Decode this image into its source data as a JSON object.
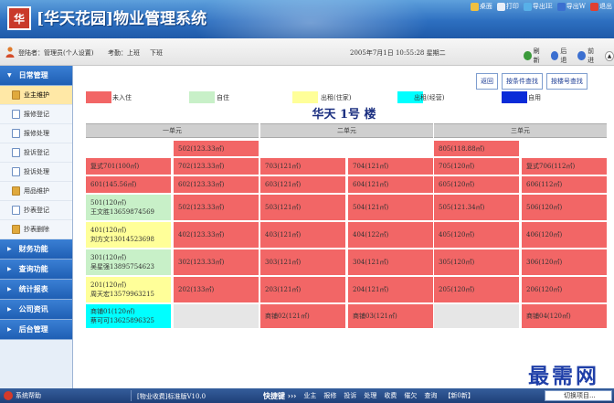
{
  "header": {
    "logo_char": "华",
    "title": "[华天花园]物业管理系统",
    "tools": [
      {
        "label": "桌面",
        "icon": "home-icon",
        "color": "#f0c040"
      },
      {
        "label": "打印",
        "icon": "print-icon",
        "color": "#e8eef8"
      },
      {
        "label": "导出IE",
        "icon": "export-ie-icon",
        "color": "#58b0e8"
      },
      {
        "label": "导出W",
        "icon": "export-word-icon",
        "color": "#3b6fd0"
      },
      {
        "label": "退出",
        "icon": "exit-icon",
        "color": "#e04030"
      }
    ]
  },
  "infobar": {
    "user_label": "登陆者：管理员(个人设置)",
    "attendance_label": "考勤：上班",
    "off_label": "下班",
    "datetime": "2005年7月1日 10:55:28 星期二",
    "nav": [
      {
        "label": "刷新",
        "icon": "refresh-icon"
      },
      {
        "label": "后退",
        "icon": "back-icon"
      },
      {
        "label": "前进",
        "icon": "forward-icon"
      }
    ]
  },
  "sidebar": {
    "sections": [
      {
        "label": "日常管理",
        "open": true,
        "items": [
          {
            "label": "业主维护",
            "active": true,
            "icon": "folder-icon"
          },
          {
            "label": "报修登记",
            "icon": "document-icon"
          },
          {
            "label": "报修处理",
            "icon": "document-icon"
          },
          {
            "label": "投诉登记",
            "icon": "document-icon"
          },
          {
            "label": "投诉处理",
            "icon": "document-icon"
          },
          {
            "label": "用品维护",
            "icon": "folder-icon"
          },
          {
            "label": "抄表登记",
            "icon": "document-icon"
          },
          {
            "label": "抄表删除",
            "icon": "folder-icon"
          }
        ]
      },
      {
        "label": "财务功能"
      },
      {
        "label": "查询功能"
      },
      {
        "label": "统计报表"
      },
      {
        "label": "公司资讯"
      },
      {
        "label": "后台管理"
      }
    ]
  },
  "main": {
    "links": [
      "返回",
      "按条件查找",
      "按楼号查找"
    ],
    "legend": [
      {
        "label": "未入住",
        "color": "#f26666"
      },
      {
        "label": "自住",
        "color": "#c8f0c8"
      },
      {
        "label": "出租(住家)",
        "color": "#ffff99"
      },
      {
        "label": "出租(经营)",
        "color": "#00ffff"
      },
      {
        "label": "自用",
        "color": "#0a2bd8"
      }
    ],
    "building_title": "华天 1号 楼",
    "units": [
      "一单元",
      "二单元",
      "三单元"
    ],
    "rows": [
      [
        [
          {
            "lines": [
              "502(123.33㎡)"
            ],
            "status": "vacant",
            "col": 1
          }
        ],
        [],
        [
          {
            "lines": [
              "805(118.88㎡)"
            ],
            "status": "vacant",
            "col": 0
          }
        ]
      ],
      [
        [
          {
            "lines": [
              "复式701(100㎡)"
            ],
            "status": "vacant",
            "col": 0
          },
          {
            "lines": [
              "702(123.33㎡)"
            ],
            "status": "vacant",
            "col": 1
          }
        ],
        [
          {
            "lines": [
              "703(121㎡)"
            ],
            "status": "vacant",
            "col": 0
          },
          {
            "lines": [
              "704(121㎡)"
            ],
            "status": "vacant",
            "col": 1
          }
        ],
        [
          {
            "lines": [
              "705(120㎡)"
            ],
            "status": "vacant",
            "col": 0
          },
          {
            "lines": [
              "复式706(112㎡)"
            ],
            "status": "vacant",
            "col": 1
          }
        ]
      ],
      [
        [
          {
            "lines": [
              "601(145.56㎡)"
            ],
            "status": "vacant",
            "col": 0
          },
          {
            "lines": [
              "602(123.33㎡)"
            ],
            "status": "vacant",
            "col": 1
          }
        ],
        [
          {
            "lines": [
              "603(121㎡)"
            ],
            "status": "vacant",
            "col": 0
          },
          {
            "lines": [
              "604(121㎡)"
            ],
            "status": "vacant",
            "col": 1
          }
        ],
        [
          {
            "lines": [
              "605(120㎡)"
            ],
            "status": "vacant",
            "col": 0
          },
          {
            "lines": [
              "606(112㎡)"
            ],
            "status": "vacant",
            "col": 1
          }
        ]
      ],
      [
        [
          {
            "lines": [
              "501(120㎡)",
              "王文胜13659874569"
            ],
            "status": "self",
            "col": 0
          },
          {
            "lines": [
              "502(123.33㎡)"
            ],
            "status": "vacant",
            "col": 1
          }
        ],
        [
          {
            "lines": [
              "503(121㎡)"
            ],
            "status": "vacant",
            "col": 0
          },
          {
            "lines": [
              "504(121㎡)"
            ],
            "status": "vacant",
            "col": 1
          }
        ],
        [
          {
            "lines": [
              "505(121.34㎡)"
            ],
            "status": "vacant",
            "col": 0
          },
          {
            "lines": [
              "506(120㎡)"
            ],
            "status": "vacant",
            "col": 1
          }
        ]
      ],
      [
        [
          {
            "lines": [
              "401(120㎡)",
              "刘方文13014523698"
            ],
            "status": "rent-home",
            "col": 0
          },
          {
            "lines": [
              "402(123.33㎡)"
            ],
            "status": "vacant",
            "col": 1
          }
        ],
        [
          {
            "lines": [
              "403(121㎡)"
            ],
            "status": "vacant",
            "col": 0
          },
          {
            "lines": [
              "404(122㎡)"
            ],
            "status": "vacant",
            "col": 1
          }
        ],
        [
          {
            "lines": [
              "405(120㎡)"
            ],
            "status": "vacant",
            "col": 0
          },
          {
            "lines": [
              "406(120㎡)"
            ],
            "status": "vacant",
            "col": 1
          }
        ]
      ],
      [
        [
          {
            "lines": [
              "301(120㎡)",
              "吴星强13895754623"
            ],
            "status": "self",
            "col": 0
          },
          {
            "lines": [
              "302(123.33㎡)"
            ],
            "status": "vacant",
            "col": 1
          }
        ],
        [
          {
            "lines": [
              "303(121㎡)"
            ],
            "status": "vacant",
            "col": 0
          },
          {
            "lines": [
              "304(121㎡)"
            ],
            "status": "vacant",
            "col": 1
          }
        ],
        [
          {
            "lines": [
              "305(120㎡)"
            ],
            "status": "vacant",
            "col": 0
          },
          {
            "lines": [
              "306(120㎡)"
            ],
            "status": "vacant",
            "col": 1
          }
        ]
      ],
      [
        [
          {
            "lines": [
              "201(120㎡)",
              "周天宏13579963215"
            ],
            "status": "rent-home",
            "col": 0
          },
          {
            "lines": [
              "202(133㎡)"
            ],
            "status": "vacant",
            "col": 1
          }
        ],
        [
          {
            "lines": [
              "203(121㎡)"
            ],
            "status": "vacant",
            "col": 0
          },
          {
            "lines": [
              "204(121㎡)"
            ],
            "status": "vacant",
            "col": 1
          }
        ],
        [
          {
            "lines": [
              "205(120㎡)"
            ],
            "status": "vacant",
            "col": 0
          },
          {
            "lines": [
              "206(120㎡)"
            ],
            "status": "vacant",
            "col": 1
          }
        ]
      ],
      [
        [
          {
            "lines": [
              "商铺01(120㎡)",
              "蔡可可13625896325"
            ],
            "status": "rent-business",
            "col": 0
          }
        ],
        [
          {
            "lines": [
              "商铺02(121㎡)"
            ],
            "status": "vacant",
            "col": 0
          },
          {
            "lines": [
              "商铺03(121㎡)"
            ],
            "status": "vacant",
            "col": 1
          }
        ],
        [
          {
            "lines": [
              "商铺04(120㎡)"
            ],
            "status": "vacant",
            "col": 1
          }
        ]
      ]
    ]
  },
  "footer": {
    "help": "系统帮助",
    "version": "[物业收费]标准版V10.0",
    "quick_label": "快捷键 ›››",
    "quick_items": [
      "业主",
      "报修",
      "投诉",
      "处理",
      "收费",
      "催欠",
      "查询",
      "【新0新】"
    ],
    "switch_label": "切换项目..."
  },
  "watermark": "最需网",
  "status_colors": {
    "vacant": "#f26666",
    "self": "#c8f0c8",
    "rent-home": "#ffff99",
    "rent-business": "#00ffff",
    "own-use": "#0a2bd8"
  }
}
